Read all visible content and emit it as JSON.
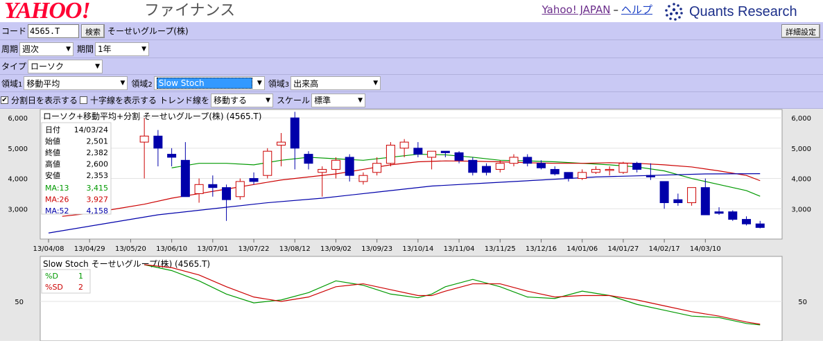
{
  "header": {
    "logo_text": "YAHOO!",
    "logo_suffix": "ファイナンス",
    "link_yahoo": "Yahoo! JAPAN",
    "separator": "–",
    "link_help": "ヘルプ",
    "brand": "Quants Research",
    "brand_icon": "dotted-circle-icon"
  },
  "toolbar": {
    "code_label": "コード",
    "code_value": "4565.T",
    "search_label": "検索",
    "company_name": "そーせいグループ(株)",
    "detail_label": "詳細設定",
    "period_label": "周期",
    "period_value": "週次",
    "span_label": "期間",
    "span_value": "1年",
    "type_label": "タイプ",
    "type_value": "ローソク",
    "area1_label": "領域",
    "area1_num": "1",
    "area1_value": "移動平均",
    "area2_label": "領域",
    "area2_num": "2",
    "area2_value": "Slow Stoch",
    "area3_label": "領域",
    "area3_num": "3",
    "area3_value": "出来高",
    "split_label": "分割日を表示する",
    "split_checked": true,
    "cross_label": "十字線を表示する",
    "cross_checked": false,
    "trend_label": "トレンド線を",
    "trend_value": "移動する",
    "scale_label": "スケール",
    "scale_value": "標準"
  },
  "chart_data": [
    {
      "type": "candlestick",
      "title": "ローソク+移動平均+分割 そーせいグループ(株) (4565.T)",
      "y_ticks": [
        "6,000",
        "5,000",
        "4,000",
        "3,000"
      ],
      "ylim": [
        2000,
        6300
      ],
      "x_ticks": [
        "13/04/08",
        "13/04/29",
        "13/05/20",
        "13/06/10",
        "13/07/01",
        "13/07/22",
        "13/08/12",
        "13/09/02",
        "13/09/23",
        "13/10/14",
        "13/11/04",
        "13/11/25",
        "13/12/16",
        "14/01/06",
        "14/01/27",
        "14/02/17",
        "14/03/10"
      ],
      "info": {
        "rows": [
          {
            "k": "日付",
            "v": "14/03/24"
          },
          {
            "k": "始値",
            "v": "2,501"
          },
          {
            "k": "終値",
            "v": "2,382"
          },
          {
            "k": "高値",
            "v": "2,600"
          },
          {
            "k": "安値",
            "v": "2,353"
          }
        ],
        "ma": [
          {
            "k": "MA:13",
            "v": "3,415",
            "color": "#009900"
          },
          {
            "k": "MA:26",
            "v": "3,927",
            "color": "#cc0000"
          },
          {
            "k": "MA:52",
            "v": "4,158",
            "color": "#0000aa"
          }
        ]
      },
      "candles": [
        {
          "x": 7,
          "o": 5200,
          "c": 5400,
          "h": 6000,
          "l": 4000
        },
        {
          "x": 8,
          "o": 5400,
          "c": 5000,
          "h": 5600,
          "l": 4400
        },
        {
          "x": 9,
          "o": 4800,
          "c": 4700,
          "h": 5000,
          "l": 4400
        },
        {
          "x": 10,
          "o": 4600,
          "c": 3400,
          "h": 5200,
          "l": 3400
        },
        {
          "x": 11,
          "o": 3500,
          "c": 3800,
          "h": 4000,
          "l": 3200
        },
        {
          "x": 12,
          "o": 3800,
          "c": 3700,
          "h": 4100,
          "l": 3400
        },
        {
          "x": 13,
          "o": 3700,
          "c": 3300,
          "h": 3800,
          "l": 2600
        },
        {
          "x": 14,
          "o": 3400,
          "c": 3900,
          "h": 4000,
          "l": 3300
        },
        {
          "x": 15,
          "o": 4000,
          "c": 3900,
          "h": 4200,
          "l": 3800
        },
        {
          "x": 16,
          "o": 4100,
          "c": 4900,
          "h": 5000,
          "l": 4000
        },
        {
          "x": 17,
          "o": 5100,
          "c": 5200,
          "h": 5500,
          "l": 4400
        },
        {
          "x": 18,
          "o": 6000,
          "c": 5000,
          "h": 6200,
          "l": 4300
        },
        {
          "x": 19,
          "o": 4800,
          "c": 4500,
          "h": 4900,
          "l": 4300
        },
        {
          "x": 20,
          "o": 4200,
          "c": 4300,
          "h": 4400,
          "l": 3400
        },
        {
          "x": 21,
          "o": 4300,
          "c": 4600,
          "h": 4700,
          "l": 4000
        },
        {
          "x": 22,
          "o": 4700,
          "c": 4100,
          "h": 4800,
          "l": 3900
        },
        {
          "x": 23,
          "o": 3900,
          "c": 4100,
          "h": 4200,
          "l": 3800
        },
        {
          "x": 24,
          "o": 4200,
          "c": 4500,
          "h": 4700,
          "l": 4100
        },
        {
          "x": 25,
          "o": 4500,
          "c": 5100,
          "h": 5200,
          "l": 4400
        },
        {
          "x": 26,
          "o": 5000,
          "c": 5200,
          "h": 5300,
          "l": 4700
        },
        {
          "x": 27,
          "o": 5000,
          "c": 4800,
          "h": 5200,
          "l": 4700
        },
        {
          "x": 28,
          "o": 4700,
          "c": 4900,
          "h": 4900,
          "l": 4300
        },
        {
          "x": 29,
          "o": 4900,
          "c": 4850,
          "h": 4900,
          "l": 4700
        },
        {
          "x": 30,
          "o": 4850,
          "c": 4600,
          "h": 4900,
          "l": 4500
        },
        {
          "x": 31,
          "o": 4600,
          "c": 4200,
          "h": 4700,
          "l": 4100
        },
        {
          "x": 32,
          "o": 4400,
          "c": 4200,
          "h": 4500,
          "l": 4100
        },
        {
          "x": 33,
          "o": 4300,
          "c": 4500,
          "h": 4600,
          "l": 4200
        },
        {
          "x": 34,
          "o": 4500,
          "c": 4700,
          "h": 4800,
          "l": 4400
        },
        {
          "x": 35,
          "o": 4700,
          "c": 4500,
          "h": 4800,
          "l": 4400
        },
        {
          "x": 36,
          "o": 4500,
          "c": 4350,
          "h": 4600,
          "l": 4300
        },
        {
          "x": 37,
          "o": 4300,
          "c": 4150,
          "h": 4400,
          "l": 4100
        },
        {
          "x": 38,
          "o": 4200,
          "c": 4000,
          "h": 4200,
          "l": 3900
        },
        {
          "x": 39,
          "o": 4000,
          "c": 4200,
          "h": 4300,
          "l": 3950
        },
        {
          "x": 40,
          "o": 4200,
          "c": 4300,
          "h": 4400,
          "l": 4150
        },
        {
          "x": 41,
          "o": 4300,
          "c": 4300,
          "h": 4400,
          "l": 4100
        },
        {
          "x": 42,
          "o": 4200,
          "c": 4500,
          "h": 4550,
          "l": 4150
        },
        {
          "x": 43,
          "o": 4500,
          "c": 4300,
          "h": 4550,
          "l": 4200
        },
        {
          "x": 44,
          "o": 4100,
          "c": 4050,
          "h": 4500,
          "l": 3950
        },
        {
          "x": 45,
          "o": 3900,
          "c": 3200,
          "h": 3900,
          "l": 3000
        },
        {
          "x": 46,
          "o": 3300,
          "c": 3200,
          "h": 3500,
          "l": 3100
        },
        {
          "x": 47,
          "o": 3200,
          "c": 3700,
          "h": 3700,
          "l": 3100
        },
        {
          "x": 48,
          "o": 3700,
          "c": 2800,
          "h": 4000,
          "l": 2800
        },
        {
          "x": 49,
          "o": 2900,
          "c": 2850,
          "h": 3050,
          "l": 2800
        },
        {
          "x": 50,
          "o": 2900,
          "c": 2650,
          "h": 2950,
          "l": 2600
        },
        {
          "x": 51,
          "o": 2650,
          "c": 2500,
          "h": 2750,
          "l": 2450
        },
        {
          "x": 52,
          "o": 2501,
          "c": 2382,
          "h": 2600,
          "l": 2353
        }
      ],
      "series": [
        {
          "name": "MA:13",
          "color": "#009900",
          "values": [
            [
              9,
              4350
            ],
            [
              11,
              4500
            ],
            [
              13,
              4500
            ],
            [
              15,
              4450
            ],
            [
              17,
              4600
            ],
            [
              19,
              4700
            ],
            [
              21,
              4650
            ],
            [
              23,
              4600
            ],
            [
              25,
              4700
            ],
            [
              27,
              4800
            ],
            [
              29,
              4780
            ],
            [
              31,
              4700
            ],
            [
              33,
              4600
            ],
            [
              35,
              4580
            ],
            [
              37,
              4550
            ],
            [
              39,
              4500
            ],
            [
              41,
              4450
            ],
            [
              43,
              4380
            ],
            [
              45,
              4250
            ],
            [
              47,
              4000
            ],
            [
              49,
              3800
            ],
            [
              51,
              3600
            ],
            [
              52,
              3415
            ]
          ]
        },
        {
          "name": "MA:26",
          "color": "#cc0000",
          "values": [
            [
              1,
              2750
            ],
            [
              3,
              2850
            ],
            [
              5,
              3000
            ],
            [
              7,
              3150
            ],
            [
              9,
              3350
            ],
            [
              11,
              3500
            ],
            [
              13,
              3650
            ],
            [
              15,
              3800
            ],
            [
              17,
              3950
            ],
            [
              19,
              4050
            ],
            [
              21,
              4150
            ],
            [
              23,
              4300
            ],
            [
              25,
              4450
            ],
            [
              27,
              4550
            ],
            [
              29,
              4580
            ],
            [
              31,
              4570
            ],
            [
              33,
              4550
            ],
            [
              35,
              4520
            ],
            [
              37,
              4500
            ],
            [
              39,
              4500
            ],
            [
              41,
              4520
            ],
            [
              43,
              4500
            ],
            [
              45,
              4450
            ],
            [
              47,
              4380
            ],
            [
              49,
              4250
            ],
            [
              51,
              4100
            ],
            [
              52,
              3927
            ]
          ]
        },
        {
          "name": "MA:52",
          "color": "#0000aa",
          "values": [
            [
              0,
              2200
            ],
            [
              4,
              2500
            ],
            [
              8,
              2800
            ],
            [
              12,
              3000
            ],
            [
              16,
              3200
            ],
            [
              20,
              3350
            ],
            [
              24,
              3550
            ],
            [
              28,
              3750
            ],
            [
              32,
              3850
            ],
            [
              36,
              3950
            ],
            [
              40,
              4050
            ],
            [
              44,
              4100
            ],
            [
              48,
              4150
            ],
            [
              52,
              4158
            ]
          ]
        }
      ]
    },
    {
      "type": "line",
      "title": "Slow Stoch そーせいグループ(株) (4565.T)",
      "y_ticks": [
        "50"
      ],
      "ylim": [
        0,
        100
      ],
      "info": {
        "rows": [
          {
            "k": "%D",
            "v": "1",
            "color": "#009900"
          },
          {
            "k": "%SD",
            "v": "2",
            "color": "#cc0000"
          }
        ]
      },
      "series": [
        {
          "name": "%D",
          "color": "#009900",
          "values": [
            [
              7,
              100
            ],
            [
              9,
              92
            ],
            [
              11,
              78
            ],
            [
              13,
              60
            ],
            [
              15,
              48
            ],
            [
              17,
              52
            ],
            [
              19,
              62
            ],
            [
              21,
              78
            ],
            [
              23,
              72
            ],
            [
              25,
              60
            ],
            [
              27,
              55
            ],
            [
              28,
              60
            ],
            [
              29,
              70
            ],
            [
              31,
              80
            ],
            [
              33,
              70
            ],
            [
              35,
              56
            ],
            [
              37,
              54
            ],
            [
              39,
              64
            ],
            [
              41,
              58
            ],
            [
              43,
              46
            ],
            [
              45,
              38
            ],
            [
              47,
              30
            ],
            [
              49,
              28
            ],
            [
              50,
              24
            ],
            [
              51,
              20
            ],
            [
              52,
              18
            ]
          ]
        },
        {
          "name": "%SD",
          "color": "#cc0000",
          "values": [
            [
              7,
              100
            ],
            [
              9,
              96
            ],
            [
              11,
              86
            ],
            [
              13,
              70
            ],
            [
              15,
              56
            ],
            [
              17,
              50
            ],
            [
              19,
              56
            ],
            [
              21,
              70
            ],
            [
              23,
              74
            ],
            [
              25,
              66
            ],
            [
              27,
              58
            ],
            [
              28,
              58
            ],
            [
              29,
              64
            ],
            [
              31,
              74
            ],
            [
              33,
              74
            ],
            [
              35,
              64
            ],
            [
              37,
              56
            ],
            [
              39,
              58
            ],
            [
              41,
              58
            ],
            [
              43,
              52
            ],
            [
              45,
              44
            ],
            [
              47,
              36
            ],
            [
              49,
              30
            ],
            [
              50,
              26
            ],
            [
              51,
              22
            ],
            [
              52,
              19
            ]
          ]
        }
      ]
    }
  ]
}
